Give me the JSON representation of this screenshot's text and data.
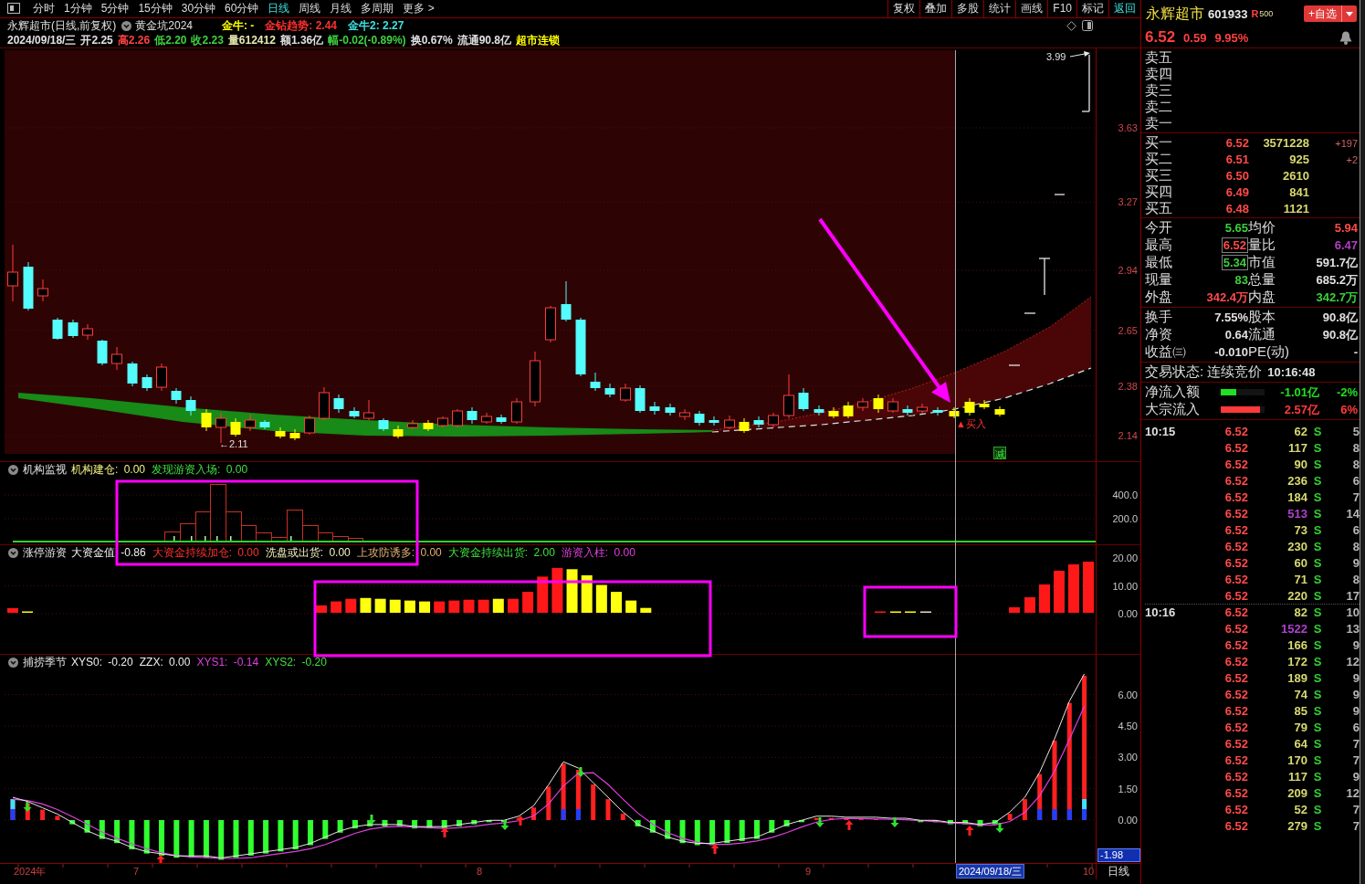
{
  "toolbar": {
    "periods": [
      {
        "label": "分时",
        "selected": false
      },
      {
        "label": "1分钟",
        "selected": false
      },
      {
        "label": "5分钟",
        "selected": false
      },
      {
        "label": "15分钟",
        "selected": false
      },
      {
        "label": "30分钟",
        "selected": false
      },
      {
        "label": "60分钟",
        "selected": false
      },
      {
        "label": "日线",
        "selected": true
      },
      {
        "label": "周线",
        "selected": false
      },
      {
        "label": "月线",
        "selected": false
      },
      {
        "label": "多周期",
        "selected": false
      },
      {
        "label": "更多 >",
        "selected": false
      }
    ],
    "tools": [
      {
        "label": "复权",
        "kind": "tool"
      },
      {
        "label": "叠加",
        "kind": "tool"
      },
      {
        "label": "多股",
        "kind": "tool"
      },
      {
        "label": "统计",
        "kind": "tool"
      },
      {
        "label": "画线",
        "kind": "tool"
      },
      {
        "label": "F10",
        "kind": "tool"
      },
      {
        "label": "标记",
        "kind": "tool"
      },
      {
        "label": "返回",
        "kind": "back"
      }
    ]
  },
  "chart_header": {
    "title": "永辉超市(日线,前复权)",
    "formula": "黄金坑2024",
    "indicators": [
      {
        "label": "金牛: -",
        "color": "#ffff00"
      },
      {
        "label": "金钻趋势: 2.44",
        "color": "#ff3030"
      },
      {
        "label": "金牛2: 2.27",
        "color": "#40e0e0"
      }
    ],
    "quote": [
      {
        "text": "2024/09/18/三",
        "color": "#e0e0e0"
      },
      {
        "text": "开2.25",
        "color": "#e0e0e0"
      },
      {
        "text": "高2.26",
        "color": "#ff4040"
      },
      {
        "text": "低2.20",
        "color": "#40d040"
      },
      {
        "text": "收2.23",
        "color": "#40d040"
      },
      {
        "text": "量612412",
        "color": "#e8e8b0"
      },
      {
        "text": "额1.36亿",
        "color": "#e0e0e0"
      },
      {
        "text": "幅-0.02(-0.89%)",
        "color": "#40d040"
      },
      {
        "text": "换0.67%",
        "color": "#e0e0e0"
      },
      {
        "text": "流通90.8亿",
        "color": "#e0e0e0"
      },
      {
        "text": "超市连锁",
        "color": "#ffff00"
      }
    ]
  },
  "main_chart": {
    "price_ticks": [
      "3.63",
      "3.27",
      "2.94",
      "2.65",
      "2.38",
      "2.14"
    ],
    "high_label": "3.99",
    "low_label": "←2.11",
    "buy_signal": "▲买入",
    "reduce_signal": "减"
  },
  "panels": [
    {
      "kind": "histogram",
      "title": "机构监视",
      "values": [
        {
          "label": "机构建仓: 0.00",
          "color": "#f0f080"
        },
        {
          "label": "发现游资入场: 0.00",
          "color": "#40e040"
        }
      ],
      "ticks": [
        "400.0",
        "200.0"
      ]
    },
    {
      "kind": "bars",
      "title": "涨停游资",
      "values": [
        {
          "label": "大资金值 -0.86",
          "color": "#f0f0f0"
        },
        {
          "label": "大资金持续加仓: 0.00",
          "color": "#ff3030"
        },
        {
          "label": "洗盘或出货: 0.00",
          "color": "#f0f0c0"
        },
        {
          "label": "上攻防诱多: 0.00",
          "color": "#e0b070"
        },
        {
          "label": "大资金持续出货: 2.00",
          "color": "#40e040"
        },
        {
          "label": "游资入柱: 0.00",
          "color": "#e040e0"
        }
      ],
      "ticks": [
        "20.00",
        "10.00",
        "0.00"
      ]
    },
    {
      "kind": "oscillator",
      "title": "捕捞季节",
      "values": [
        {
          "label": "XYS0: -0.20",
          "color": "#f0f0f0"
        },
        {
          "label": "ZZX: 0.00",
          "color": "#f0f0f0"
        },
        {
          "label": "XYS1: -0.14",
          "color": "#e040e0"
        },
        {
          "label": "XYS2: -0.20",
          "color": "#40e040"
        }
      ],
      "ticks": [
        "6.00",
        "4.50",
        "3.00",
        "1.50",
        "0.00"
      ],
      "current": "-1.98"
    }
  ],
  "time_axis": {
    "labels": [
      {
        "label": "2024年",
        "kind": "date"
      },
      {
        "label": "7",
        "kind": "date"
      },
      {
        "label": "8",
        "kind": "date"
      },
      {
        "label": "9",
        "kind": "date"
      },
      {
        "label": "2024/09/18/三",
        "kind": "cursor"
      },
      {
        "label": "10",
        "kind": "date"
      }
    ],
    "period": "日线"
  },
  "quote_panel": {
    "name": "永辉超市",
    "code": "601933",
    "rating": "R",
    "rating_number": "500",
    "watch_button": "+自选",
    "price": "6.52",
    "change": "0.59",
    "change_pct": "9.95%",
    "asks": [
      "卖五",
      "卖四",
      "卖三",
      "卖二",
      "卖一"
    ],
    "bids": [
      {
        "label": "买一",
        "price": "6.52",
        "volume": "3571228",
        "delta": "+197"
      },
      {
        "label": "买二",
        "price": "6.51",
        "volume": "925",
        "delta": "+2"
      },
      {
        "label": "买三",
        "price": "6.50",
        "volume": "2610"
      },
      {
        "label": "买四",
        "price": "6.49",
        "volume": "841"
      },
      {
        "label": "买五",
        "price": "6.48",
        "volume": "1121"
      }
    ],
    "stats": [
      {
        "label": "今开",
        "value": "5.65",
        "color": "#3cd03c",
        "framed": false
      },
      {
        "label": "均价",
        "value": "5.94",
        "color": "#ff4a4a",
        "framed": false
      },
      {
        "label": "最高",
        "value": "6.52",
        "color": "#ff4a4a",
        "framed": true
      },
      {
        "label": "量比",
        "value": "6.47",
        "color": "#b040c0",
        "framed": false
      },
      {
        "label": "最低",
        "value": "5.34",
        "color": "#3cd03c",
        "framed": true
      },
      {
        "label": "市值",
        "value": "591.7亿",
        "color": "#e0e0e0",
        "framed": false
      },
      {
        "label": "现量",
        "value": "83",
        "color": "#3cd03c",
        "framed": false
      },
      {
        "label": "总量",
        "value": "685.2万",
        "color": "#e0e0e0",
        "framed": false
      },
      {
        "label": "外盘",
        "value": "342.4万",
        "color": "#ff4a4a",
        "framed": false
      },
      {
        "label": "内盘",
        "value": "342.7万",
        "color": "#3cd03c",
        "framed": false
      }
    ],
    "fundamentals": [
      {
        "label": "换手",
        "value": "7.55%"
      },
      {
        "label": "股本",
        "value": "90.8亿"
      },
      {
        "label": "净资",
        "value": "0.64"
      },
      {
        "label": "流通",
        "value": "90.8亿"
      },
      {
        "label": "收益㈢",
        "value": "-0.010"
      },
      {
        "label": "PE(动)",
        "value": "-"
      }
    ],
    "status": {
      "label": "交易状态: 连续竞价",
      "time": "10:16:48"
    },
    "flows": [
      {
        "label": "净流入额",
        "level": 0.35,
        "color": "#20e020",
        "value": "-1.01亿",
        "pct": "-2%"
      },
      {
        "label": "大宗流入",
        "level": 0.9,
        "color": "#ff3a3a",
        "value": "2.57亿",
        "pct": "6%"
      }
    ],
    "trades": [
      {
        "time": "10:15",
        "price": "6.52",
        "volume": "62",
        "side": "S",
        "count": "5",
        "large": false
      },
      {
        "price": "6.52",
        "volume": "117",
        "side": "S",
        "count": "8",
        "large": false
      },
      {
        "price": "6.52",
        "volume": "90",
        "side": "S",
        "count": "8",
        "large": false
      },
      {
        "price": "6.52",
        "volume": "236",
        "side": "S",
        "count": "6",
        "large": false
      },
      {
        "price": "6.52",
        "volume": "184",
        "side": "S",
        "count": "7",
        "large": false
      },
      {
        "price": "6.52",
        "volume": "513",
        "side": "S",
        "count": "14",
        "large": true
      },
      {
        "price": "6.52",
        "volume": "73",
        "side": "S",
        "count": "6",
        "large": false
      },
      {
        "price": "6.52",
        "volume": "230",
        "side": "S",
        "count": "8",
        "large": false
      },
      {
        "price": "6.52",
        "volume": "60",
        "side": "S",
        "count": "9",
        "large": false
      },
      {
        "price": "6.52",
        "volume": "71",
        "side": "S",
        "count": "8",
        "large": false
      },
      {
        "price": "6.52",
        "volume": "220",
        "side": "S",
        "count": "17",
        "large": false
      },
      {
        "time": "10:16",
        "price": "6.52",
        "volume": "82",
        "side": "S",
        "count": "10",
        "large": false
      },
      {
        "price": "6.52",
        "volume": "1522",
        "side": "S",
        "count": "13",
        "large": true
      },
      {
        "price": "6.52",
        "volume": "166",
        "side": "S",
        "count": "9",
        "large": false
      },
      {
        "price": "6.52",
        "volume": "172",
        "side": "S",
        "count": "12",
        "large": false
      },
      {
        "price": "6.52",
        "volume": "189",
        "side": "S",
        "count": "9",
        "large": false
      },
      {
        "price": "6.52",
        "volume": "74",
        "side": "S",
        "count": "9",
        "large": false
      },
      {
        "price": "6.52",
        "volume": "85",
        "side": "S",
        "count": "9",
        "large": false
      },
      {
        "price": "6.52",
        "volume": "79",
        "side": "S",
        "count": "6",
        "large": false
      },
      {
        "price": "6.52",
        "volume": "64",
        "side": "S",
        "count": "7",
        "large": false
      },
      {
        "price": "6.52",
        "volume": "170",
        "side": "S",
        "count": "7",
        "large": false
      },
      {
        "price": "6.52",
        "volume": "117",
        "side": "S",
        "count": "9",
        "large": false
      },
      {
        "price": "6.52",
        "volume": "209",
        "side": "S",
        "count": "12",
        "large": false
      },
      {
        "price": "6.52",
        "volume": "52",
        "side": "S",
        "count": "7",
        "large": false
      },
      {
        "price": "6.52",
        "volume": "279",
        "side": "S",
        "count": "7",
        "large": false
      }
    ]
  }
}
